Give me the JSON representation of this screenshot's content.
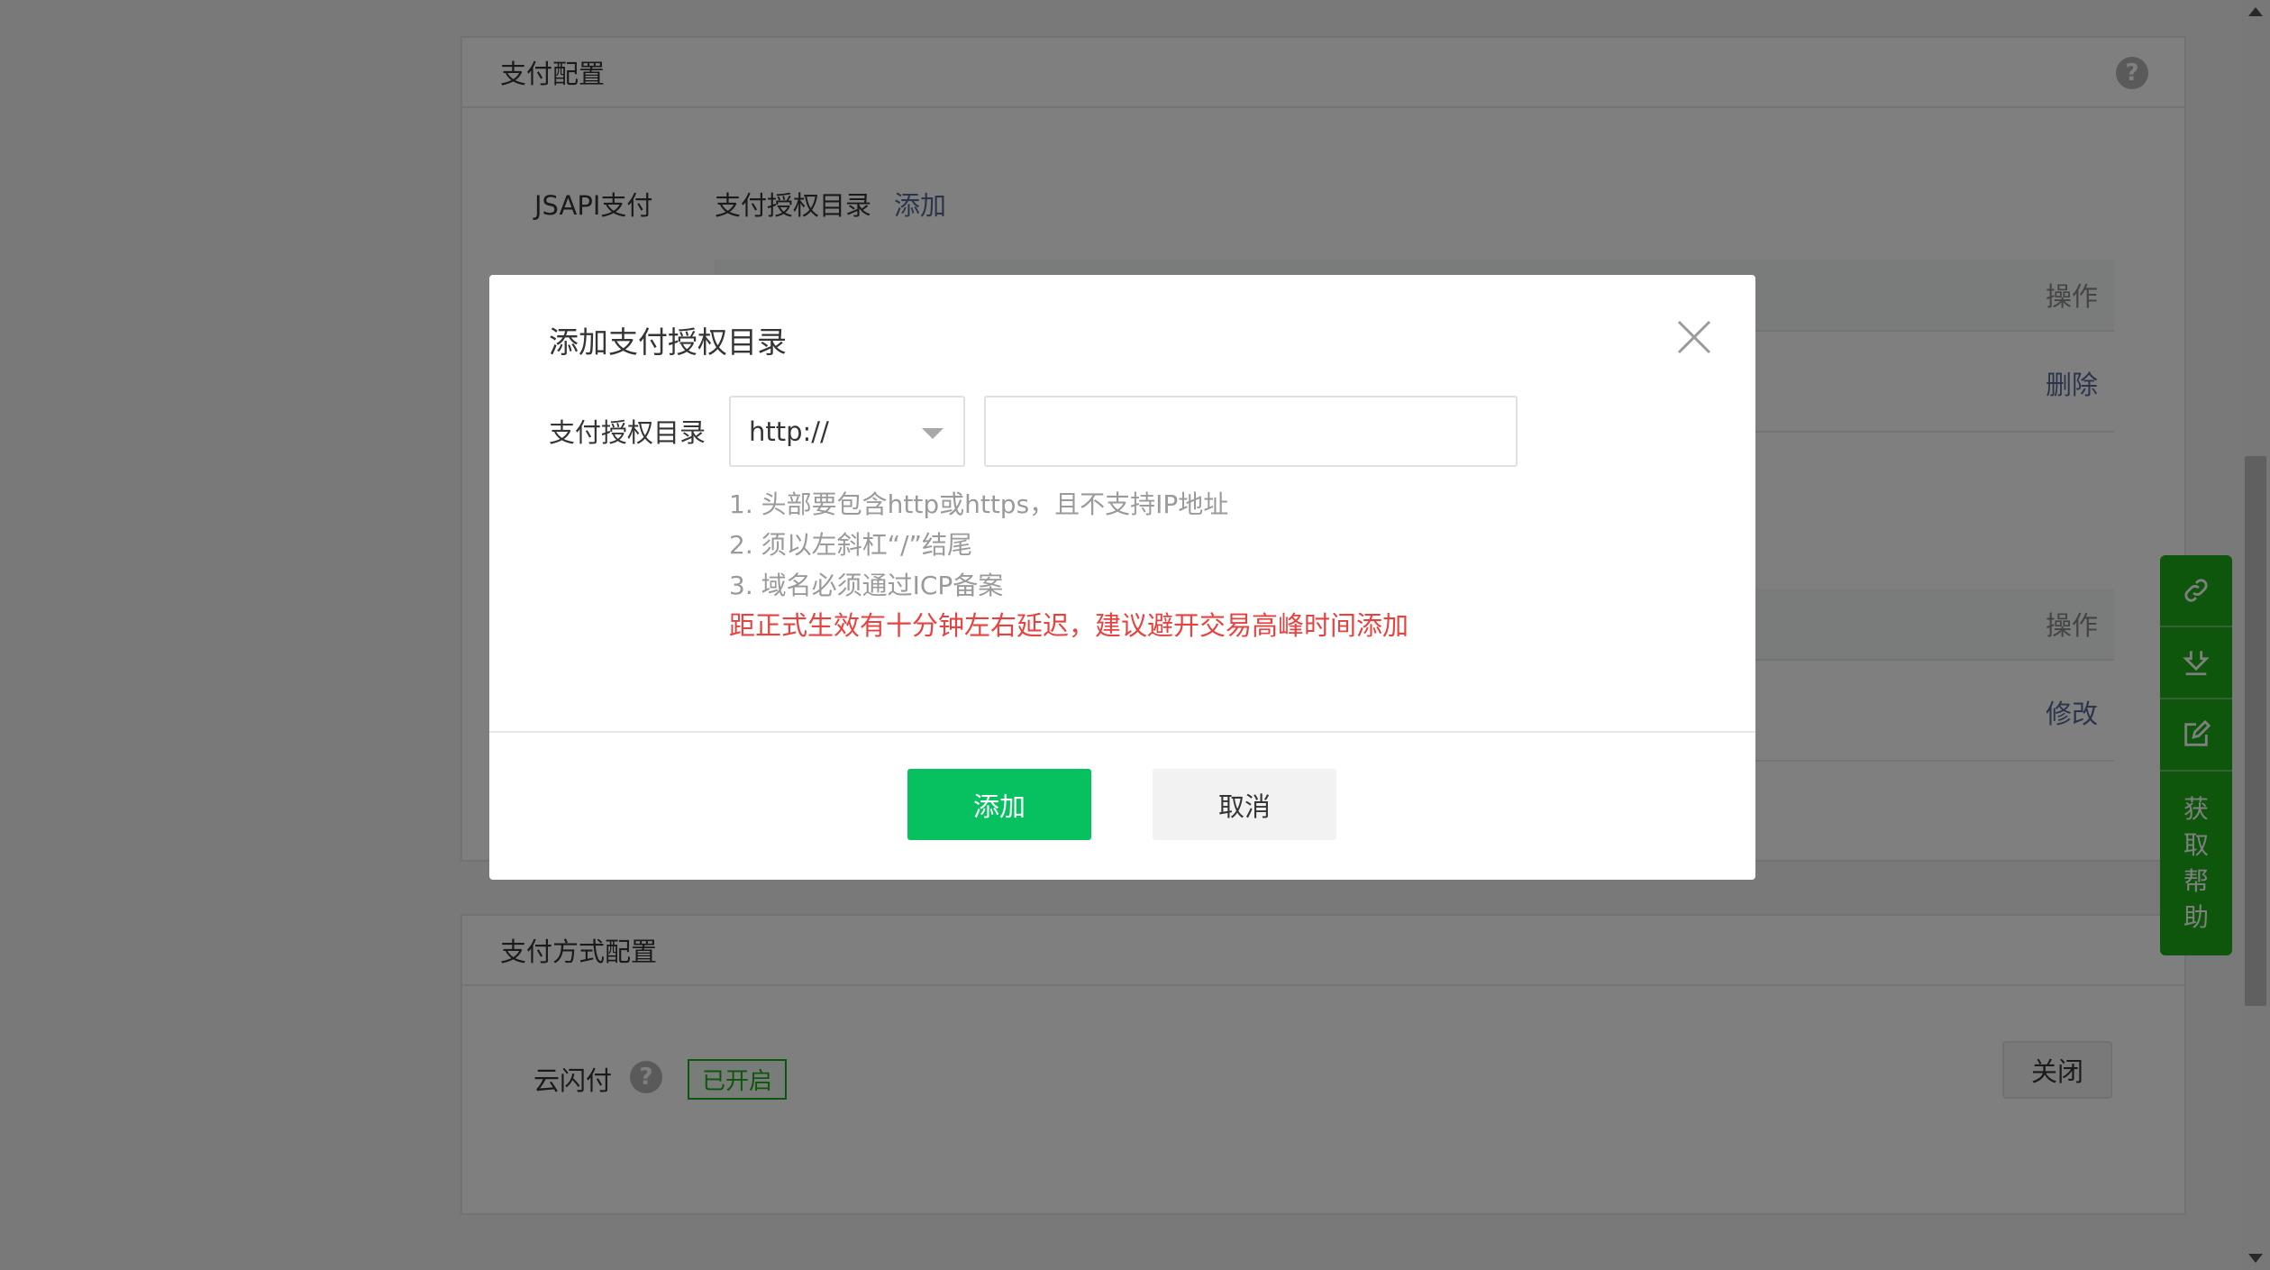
{
  "payment_config": {
    "title": "支付配置",
    "jsapi_label": "JSAPI支付",
    "auth_dir_label": "支付授权目录",
    "add_link": "添加",
    "table1": {
      "op_header": "操作",
      "row_action": "删除"
    },
    "table2": {
      "op_header": "操作",
      "row_action": "修改"
    }
  },
  "payment_method_config": {
    "title": "支付方式配置",
    "item_label": "云闪付",
    "status_badge": "已开启",
    "toggle_button": "关闭"
  },
  "float_toolbar": {
    "items": [
      "link-icon",
      "download-icon",
      "edit-icon"
    ],
    "help_chars": [
      "获",
      "取",
      "帮",
      "助"
    ]
  },
  "dialog": {
    "title": "添加支付授权目录",
    "field_label": "支付授权目录",
    "protocol_select": "http://",
    "path_value": "",
    "tips": [
      "1. 头部要包含http或https，且不支持IP地址",
      "2. 须以左斜杠“/”结尾",
      "3. 域名必须通过ICP备案"
    ],
    "warning": "距正式生效有十分钟左右延迟，建议避开交易高峰时间添加",
    "confirm_button": "添加",
    "cancel_button": "取消"
  },
  "colors": {
    "primary_green": "#07c160",
    "brand_green": "#1aad19",
    "link_blue": "#576b95",
    "warning_red": "#e64340",
    "mask": "rgba(0,0,0,0.5)"
  }
}
